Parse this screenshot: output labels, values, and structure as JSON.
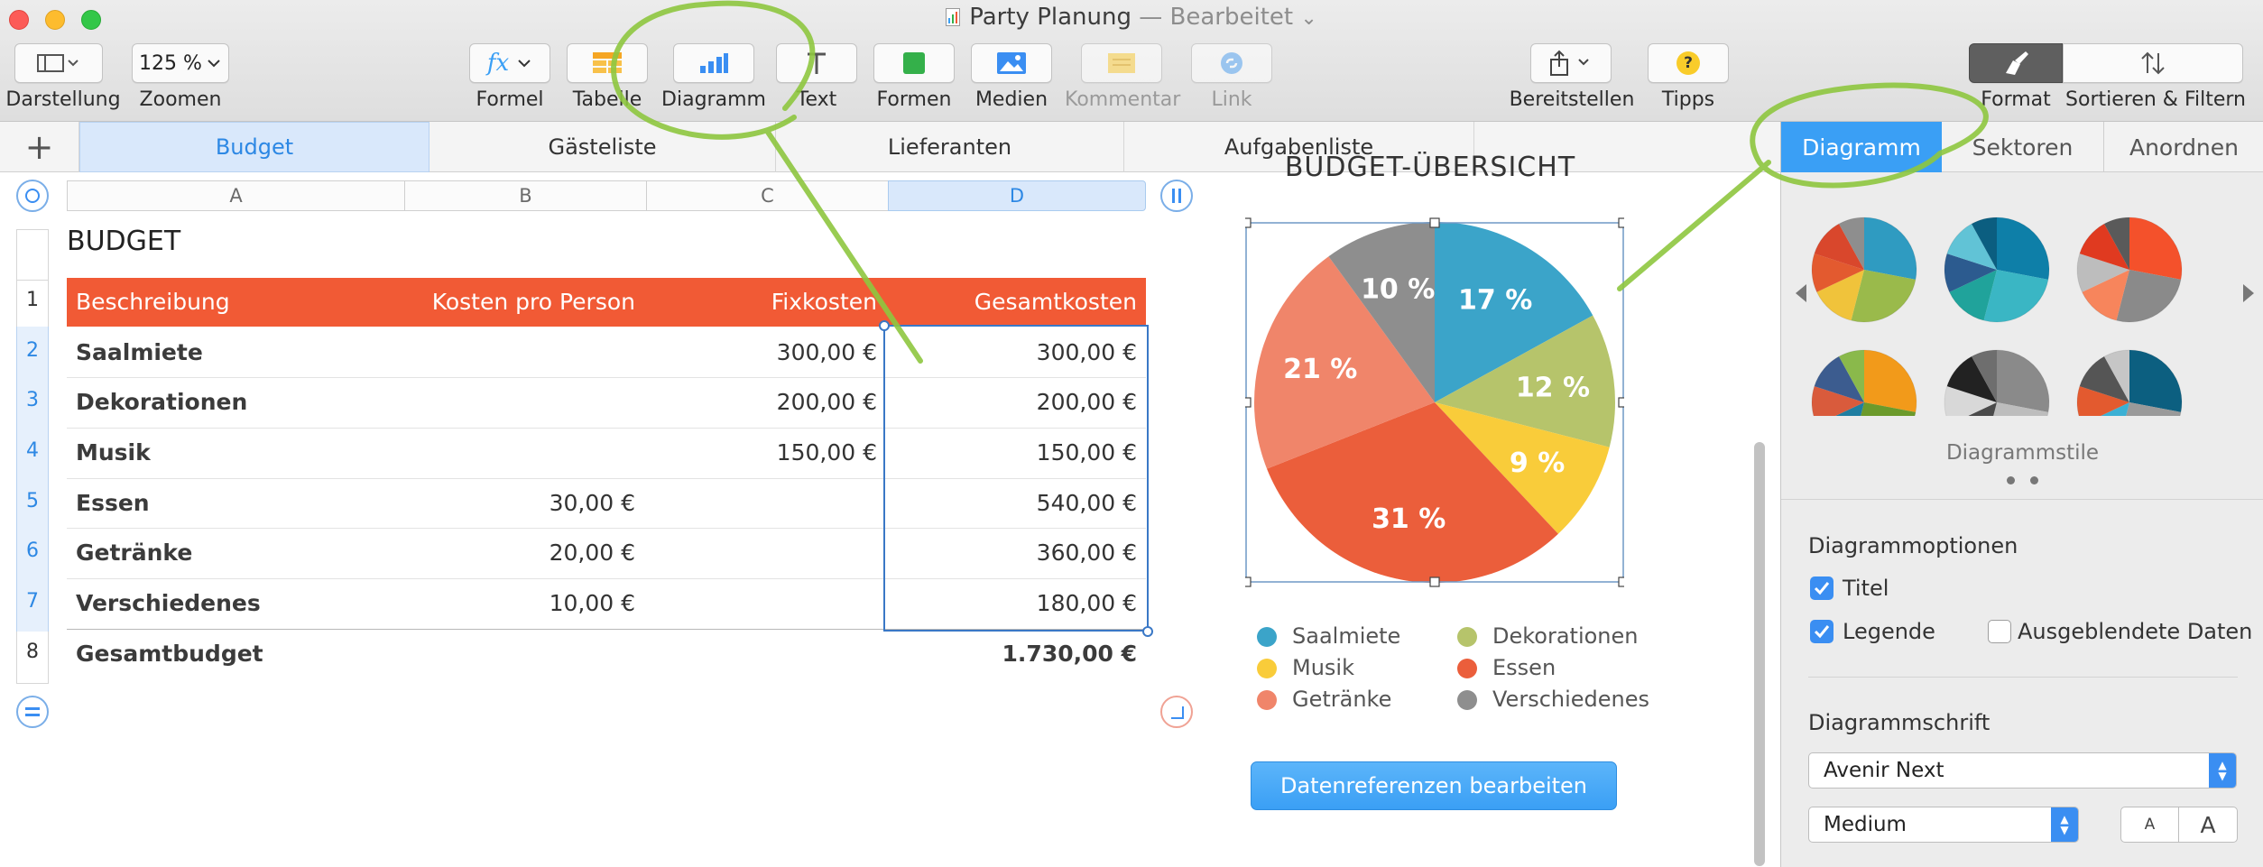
{
  "window": {
    "title": "Party Planung",
    "status": " — Bearbeitet",
    "status_chevron": "⌄"
  },
  "toolbar": {
    "view_label": "Darstellung",
    "zoom_value": "125 %",
    "zoom_label": "Zoomen",
    "formula_label": "Formel",
    "table_label": "Tabelle",
    "chart_label": "Diagramm",
    "text_label": "Text",
    "shapes_label": "Formen",
    "media_label": "Medien",
    "comment_label": "Kommentar",
    "link_label": "Link",
    "share_label": "Bereitstellen",
    "tips_label": "Tipps",
    "format_label": "Format",
    "sort_label": "Sortieren & Filtern"
  },
  "sheets": {
    "add_symbol": "+",
    "tabs": [
      "Budget",
      "Gästeliste",
      "Lieferanten",
      "Aufgabenliste"
    ],
    "active": "Budget"
  },
  "table": {
    "title": "BUDGET",
    "column_letters": [
      "A",
      "B",
      "C",
      "D"
    ],
    "headers": [
      "Beschreibung",
      "Kosten pro Person",
      "Fixkosten",
      "Gesamtkosten"
    ],
    "row_numbers": [
      "1",
      "2",
      "3",
      "4",
      "5",
      "6",
      "7",
      "8"
    ],
    "rows": [
      {
        "desc": "Saalmiete",
        "per_person": "",
        "fixed": "300,00 €",
        "total": "300,00 €"
      },
      {
        "desc": "Dekorationen",
        "per_person": "",
        "fixed": "200,00 €",
        "total": "200,00 €"
      },
      {
        "desc": "Musik",
        "per_person": "",
        "fixed": "150,00 €",
        "total": "150,00 €"
      },
      {
        "desc": "Essen",
        "per_person": "30,00 €",
        "fixed": "",
        "total": "540,00 €"
      },
      {
        "desc": "Getränke",
        "per_person": "20,00 €",
        "fixed": "",
        "total": "360,00 €"
      },
      {
        "desc": "Verschiedenes",
        "per_person": "10,00 €",
        "fixed": "",
        "total": "180,00 €"
      }
    ],
    "footer": {
      "desc": "Gesamtbudget",
      "total": "1.730,00 €"
    },
    "header_color": "#f15a35"
  },
  "chart": {
    "title": "BUDGET-ÜBERSICHT",
    "edit_button": "Datenreferenzen bearbeiten"
  },
  "chart_data": {
    "type": "pie",
    "categories": [
      "Saalmiete",
      "Dekorationen",
      "Musik",
      "Essen",
      "Getränke",
      "Verschiedenes"
    ],
    "values": [
      17,
      12,
      9,
      31,
      21,
      10
    ],
    "labels": [
      "17 %",
      "12 %",
      "9 %",
      "31 %",
      "21 %",
      "10 %"
    ],
    "colors": [
      "#3ba4c9",
      "#b6c46b",
      "#f9cc3a",
      "#eb5e3b",
      "#f0856a",
      "#8e8e8e"
    ],
    "title": "BUDGET-ÜBERSICHT",
    "legend": "bottom"
  },
  "sidebar": {
    "tabs": [
      "Diagramm",
      "Sektoren",
      "Anordnen"
    ],
    "active_tab": "Diagramm",
    "styles_label": "Diagrammstile",
    "options_title": "Diagrammoptionen",
    "opt_title": "Titel",
    "opt_legend": "Legende",
    "opt_hidden": "Ausgeblendete Daten",
    "font_title": "Diagrammschrift",
    "font_value": "Avenir Next",
    "weight_value": "Medium",
    "size_small": "A",
    "size_large": "A"
  },
  "colors": {
    "accent": "#3a9ff5",
    "annotation": "#8ec63f"
  }
}
